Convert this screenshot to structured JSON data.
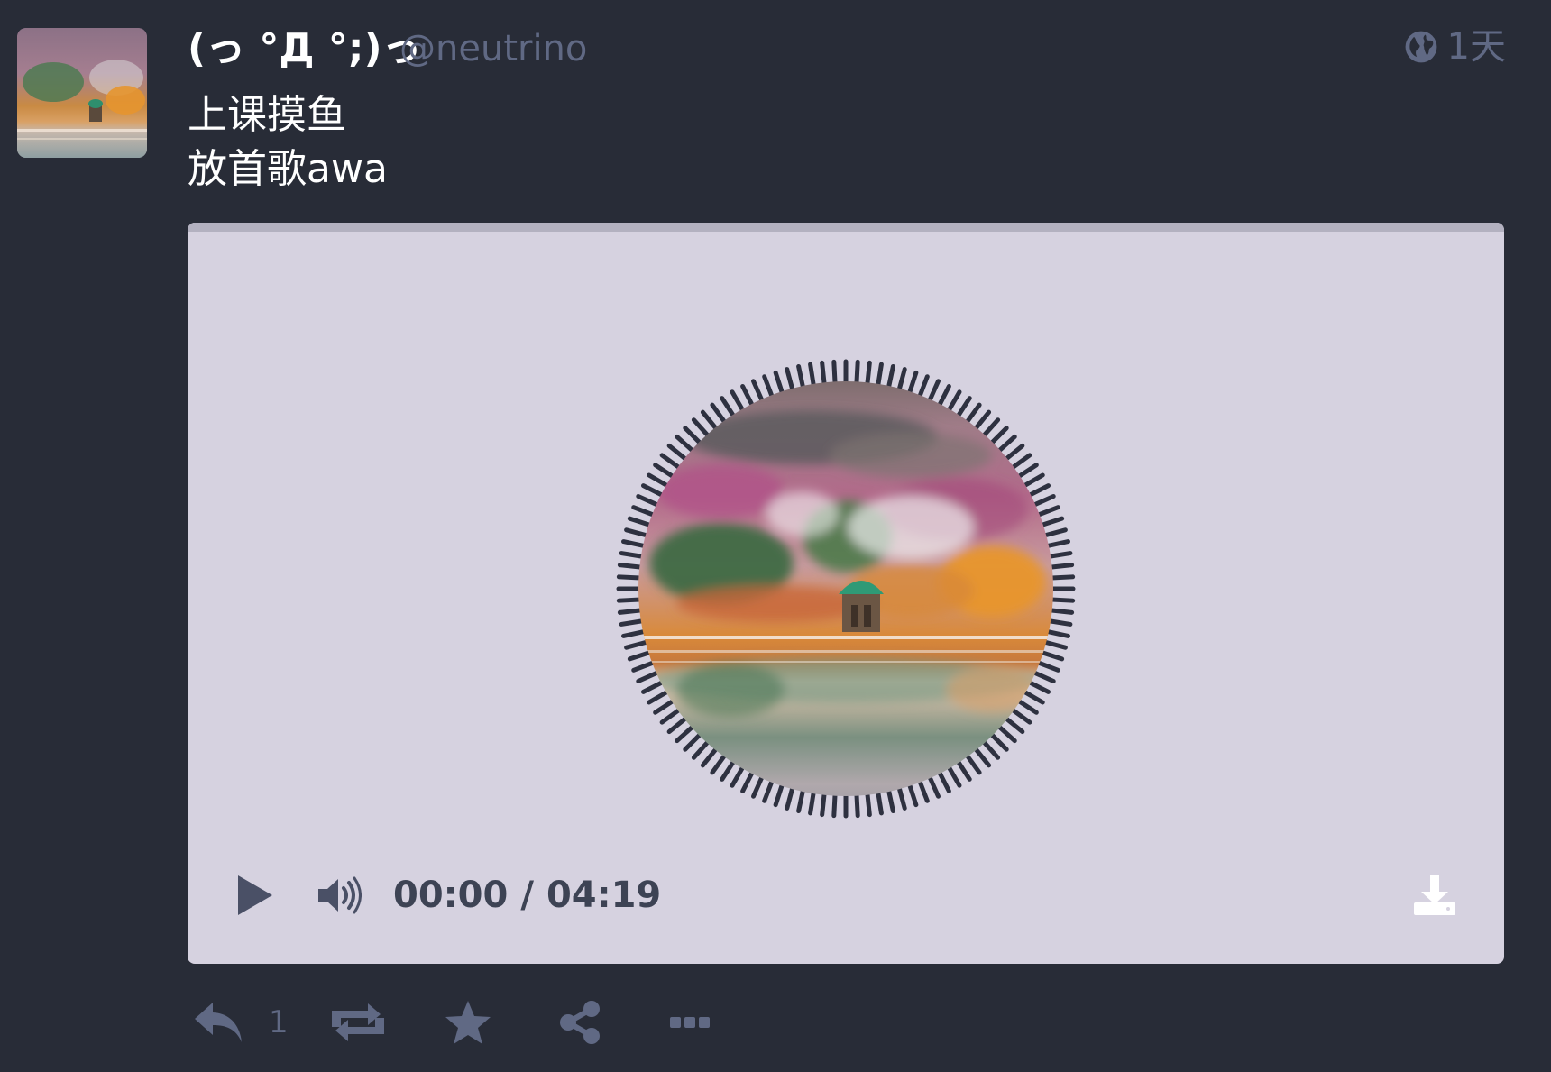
{
  "status": {
    "display_name": "(っ °Д °;)っ",
    "account": "@neutrino",
    "visibility_icon": "globe-icon",
    "relative_time": "1天",
    "content_lines": [
      "上课摸鱼",
      "放首歌awa"
    ]
  },
  "audio_player": {
    "current_time": "00:00",
    "separator": "/",
    "duration": "04:19",
    "progress": 0,
    "icons": {
      "play": "play-icon",
      "volume": "volume-icon",
      "download": "download-icon"
    }
  },
  "actions": {
    "reply_count": "1",
    "icons": [
      "reply-icon",
      "boost-icon",
      "star-icon",
      "share-icon",
      "more-icon"
    ]
  },
  "colors": {
    "background": "#282c37",
    "player_background": "#d6d2e0",
    "muted_text": "#606984",
    "primary_text": "#ffffff",
    "player_text": "#3d4354"
  }
}
